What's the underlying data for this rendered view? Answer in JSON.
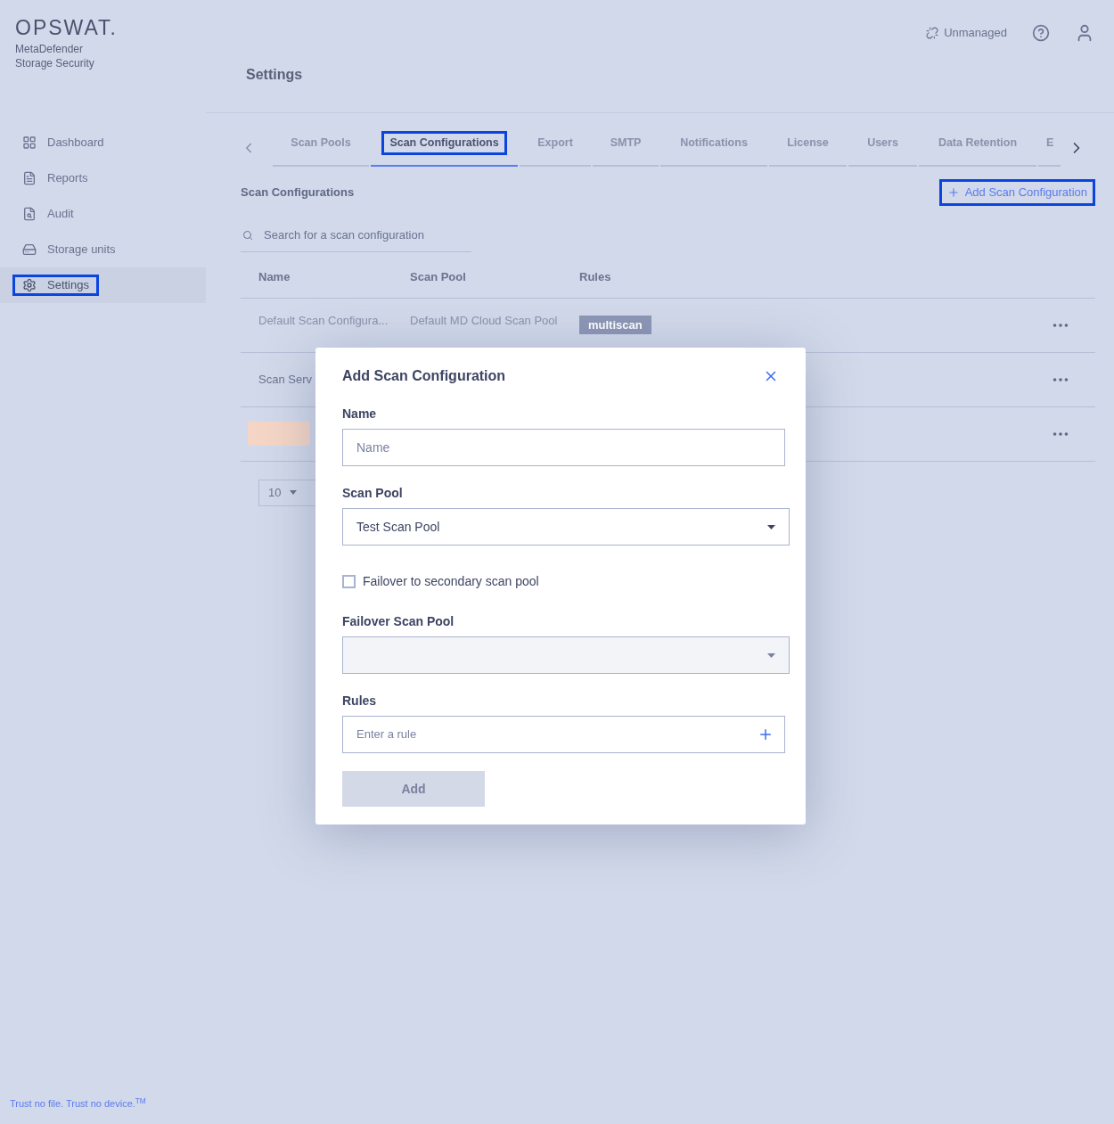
{
  "brand": {
    "logo": "OPSWAT.",
    "product_line_1": "MetaDefender",
    "product_line_2": "Storage Security"
  },
  "sidebar": {
    "items": [
      {
        "label": "Dashboard",
        "selected": false,
        "highlighted": false
      },
      {
        "label": "Reports",
        "selected": false,
        "highlighted": false
      },
      {
        "label": "Audit",
        "selected": false,
        "highlighted": false
      },
      {
        "label": "Storage units",
        "selected": false,
        "highlighted": false
      },
      {
        "label": "Settings",
        "selected": true,
        "highlighted": true
      }
    ],
    "tagline": "Trust no file. Trust no device.$^{TM}$"
  },
  "topbar": {
    "status": "Unmanaged"
  },
  "page_title": "Settings",
  "tabs": [
    {
      "label": "Scan Pools",
      "selected": false,
      "highlighted": false
    },
    {
      "label": "Scan Configurations",
      "selected": true,
      "highlighted": true
    },
    {
      "label": "Export",
      "selected": false,
      "highlighted": false
    },
    {
      "label": "SMTP",
      "selected": false,
      "highlighted": false
    },
    {
      "label": "Notifications",
      "selected": false,
      "highlighted": false
    },
    {
      "label": "License",
      "selected": false,
      "highlighted": false
    },
    {
      "label": "Users",
      "selected": false,
      "highlighted": false
    },
    {
      "label": "Data Retention",
      "selected": false,
      "highlighted": false
    },
    {
      "label": "E",
      "selected": false,
      "highlighted": false
    }
  ],
  "section": {
    "title": "Scan Configurations",
    "add_button": {
      "label": "Add Scan Configuration",
      "highlighted": true
    },
    "search": {
      "placeholder": "Search for a scan configuration"
    }
  },
  "table": {
    "columns": [
      "Name",
      "Scan Pool",
      "Rules"
    ],
    "rows": [
      {
        "kind": "full",
        "name": "Default Scan Configura...",
        "scan_pool": "Default MD Cloud Scan Pool",
        "rules": [
          "multiscan"
        ]
      },
      {
        "kind": "partial",
        "name": "Scan Serv"
      },
      {
        "kind": "redacted"
      }
    ],
    "page_size": "10"
  },
  "dialog": {
    "title": "Add Scan Configuration",
    "name": {
      "label": "Name",
      "placeholder": "Name"
    },
    "scan_pool": {
      "label": "Scan Pool",
      "value": "Test Scan Pool"
    },
    "failover": {
      "label": "Failover to secondary scan pool",
      "checked": false
    },
    "failover_pool": {
      "label": "Failover Scan Pool",
      "disabled": true
    },
    "rules": {
      "label": "Rules",
      "placeholder": "Enter a rule"
    },
    "submit": {
      "label": "Add",
      "disabled": true
    }
  }
}
